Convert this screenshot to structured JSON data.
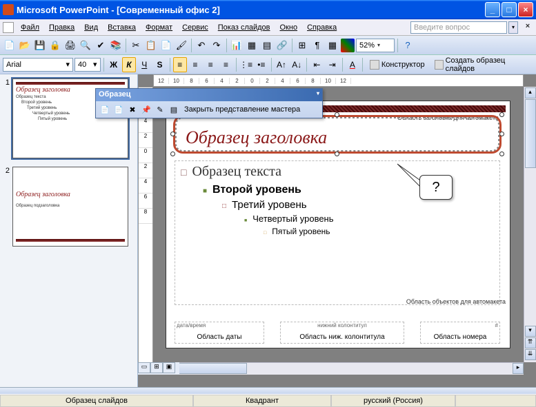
{
  "app": {
    "title": "Microsoft PowerPoint - [Современный офис 2]"
  },
  "menu": {
    "file": "Файл",
    "edit": "Правка",
    "view": "Вид",
    "insert": "Вставка",
    "format": "Формат",
    "tools": "Сервис",
    "slideshow": "Показ слайдов",
    "window": "Окно",
    "help": "Справка",
    "helpbox_placeholder": "Введите вопрос"
  },
  "toolbar": {
    "zoom": "52%"
  },
  "format": {
    "font": "Arial",
    "size": "40",
    "bold": "Ж",
    "italic": "К",
    "underline": "Ч",
    "shadow": "S",
    "designer": "Конструктор",
    "new_master": "Создать образец слайдов"
  },
  "floating": {
    "title": "Образец",
    "close_master": "Закрыть представление мастера"
  },
  "slide": {
    "title_area_label": "Область заголовка для автомакета",
    "title_text": "Образец заголовка",
    "body_l1": "Образец текста",
    "body_l2": "Второй уровень",
    "body_l3": "Третий уровень",
    "body_l4": "Четвертый уровень",
    "body_l5": "Пятый уровень",
    "obj_area_label": "Область объектов для автомакета",
    "date_label": "дата/время",
    "date_text": "Область даты",
    "footer_label": "нижний колонтитул",
    "footer_text": "Область ниж. колонтитула",
    "num_label": "#",
    "num_text": "Область номера",
    "callout": "?"
  },
  "thumbs": {
    "n1": "1",
    "n2": "2",
    "t1_title": "Образец заголовка",
    "t1_b1": "Образец текста",
    "t1_b2": "Второй уровень",
    "t1_b3": "Третий уровень",
    "t1_b4": "Четвертый уровень",
    "t1_b5": "Пятый уровень",
    "t2_title": "Образец заголовка",
    "t2_sub": "Образец подзаголовка"
  },
  "ruler": {
    "ticks": [
      "12",
      "10",
      "8",
      "6",
      "4",
      "2",
      "0",
      "2",
      "4",
      "6",
      "8",
      "10",
      "12"
    ]
  },
  "status": {
    "master": "Образец слайдов",
    "quad": "Квадрант",
    "lang": "русский (Россия)"
  }
}
